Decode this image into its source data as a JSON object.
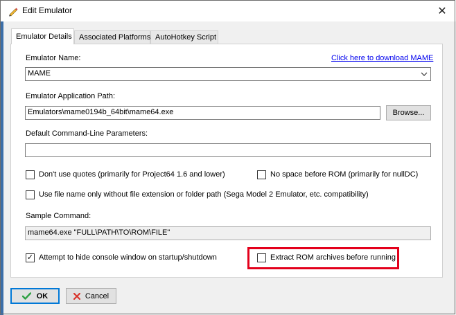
{
  "window": {
    "title": "Edit Emulator",
    "close_glyph": "✕",
    "title_icon": "pencil-icon"
  },
  "tabs": [
    {
      "label": "Emulator Details",
      "active": true
    },
    {
      "label": "Associated Platforms",
      "active": false
    },
    {
      "label": "AutoHotkey Script",
      "active": false
    }
  ],
  "form": {
    "emulator_name_label": "Emulator Name:",
    "download_link": "Click here to download MAME",
    "emulator_name_value": "MAME",
    "app_path_label": "Emulator Application Path:",
    "app_path_value": "Emulators\\mame0194b_64bit\\mame64.exe",
    "browse_label": "Browse...",
    "cmdline_label": "Default Command-Line Parameters:",
    "cmdline_value": "",
    "sample_label": "Sample Command:",
    "sample_value": "mame64.exe \"FULL\\PATH\\TO\\ROM\\FILE\""
  },
  "checkboxes": {
    "no_quotes": {
      "label": "Don't use quotes (primarily for Project64 1.6 and lower)",
      "checked": false
    },
    "no_space": {
      "label": "No space before ROM (primarily for nullDC)",
      "checked": false
    },
    "filename_only": {
      "label": "Use file name only without file extension or folder path (Sega Model 2 Emulator, etc. compatibility)",
      "checked": false
    },
    "hide_console": {
      "label": "Attempt to hide console window on startup/shutdown",
      "checked": true
    },
    "extract_rom": {
      "label": "Extract ROM archives before running",
      "checked": false
    }
  },
  "check_glyph": "✓",
  "footer": {
    "ok_label": "OK",
    "cancel_label": "Cancel",
    "ok_icon": "green-checkmark-icon",
    "cancel_icon": "red-x-icon"
  },
  "colors": {
    "highlight": "#e3001b",
    "link": "#0000ee",
    "focus": "#0078d7"
  }
}
